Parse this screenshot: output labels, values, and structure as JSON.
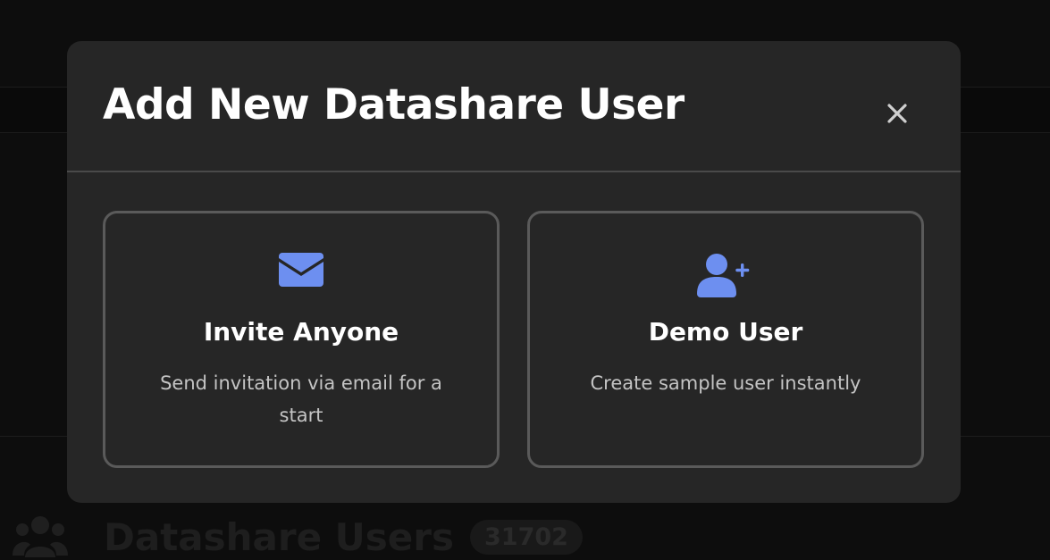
{
  "background": {
    "section_title": "Datashare Users",
    "user_count": "31702",
    "icon": "users-icon"
  },
  "modal": {
    "title": "Add New Datashare User",
    "close_icon": "close-icon",
    "options": [
      {
        "icon": "envelope-icon",
        "title": "Invite Anyone",
        "description": "Send invitation via email for a start"
      },
      {
        "icon": "user-plus-icon",
        "title": "Demo User",
        "description": "Create sample user instantly"
      }
    ]
  },
  "colors": {
    "backdrop": "#0d0d0d",
    "modal_bg": "#262626",
    "card_border": "#5a5a5a",
    "accent_icon": "#6d8ff0",
    "text_primary": "#ffffff",
    "text_secondary": "#c4c4c4"
  }
}
